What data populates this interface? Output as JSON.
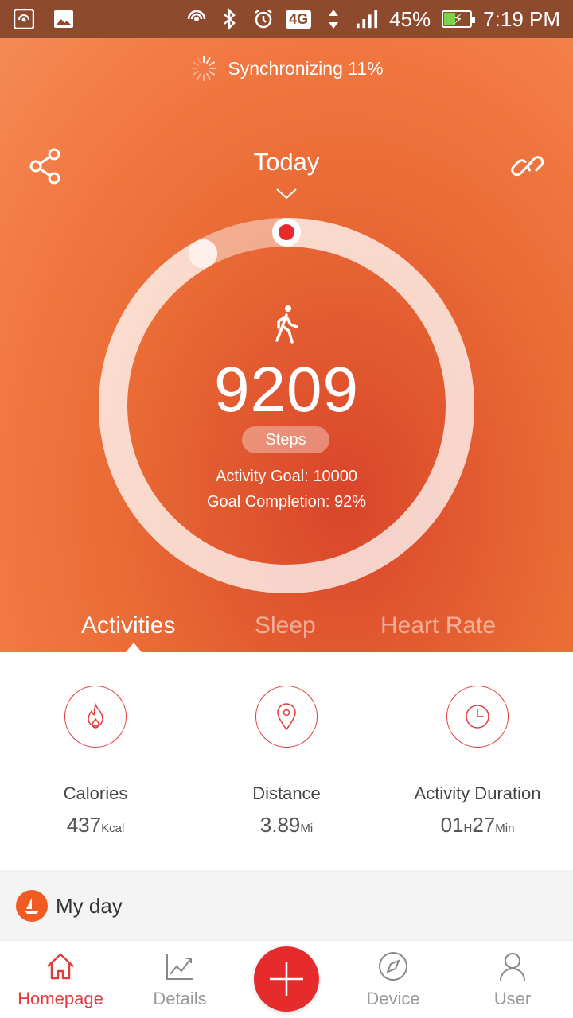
{
  "status_bar": {
    "network": "4G",
    "battery": "45%",
    "battery_level": 0.45,
    "time": "7:19 PM",
    "icons": [
      "hotspot-icon",
      "image-icon",
      "nfc-icon",
      "bluetooth-icon",
      "alarm-icon",
      "network-arrows-icon",
      "signal-icon",
      "battery-charging-icon"
    ]
  },
  "sync": {
    "text": "Synchronizing 11%"
  },
  "header": {
    "date_selector": "Today"
  },
  "activity_ring": {
    "steps": "9209",
    "steps_label": "Steps",
    "goal_text": "Activity Goal: 10000",
    "completion_text": "Goal Completion: 92%",
    "completion_fraction": 0.92
  },
  "tabs": [
    {
      "label": "Activities",
      "active": true
    },
    {
      "label": "Sleep",
      "active": false
    },
    {
      "label": "Heart Rate",
      "active": false
    }
  ],
  "stats": [
    {
      "label": "Calories",
      "value": "437",
      "unit": "Kcal",
      "icon": "flame-icon"
    },
    {
      "label": "Distance",
      "value": "3.89",
      "unit": "Mi",
      "icon": "location-pin-icon"
    },
    {
      "label": "Activity Duration",
      "hours": "01",
      "hours_unit": "H",
      "minutes": "27",
      "minutes_unit": "Min",
      "icon": "clock-icon"
    }
  ],
  "my_day": {
    "title": "My day"
  },
  "bottom_nav": [
    {
      "label": "Homepage",
      "active": true
    },
    {
      "label": "Details",
      "active": false
    },
    {
      "label": "Device",
      "active": false
    },
    {
      "label": "User",
      "active": false
    }
  ],
  "colors": {
    "accent": "#e52b2b",
    "hero_orange": "#f27a44",
    "status_bar": "#8e4a2d"
  }
}
